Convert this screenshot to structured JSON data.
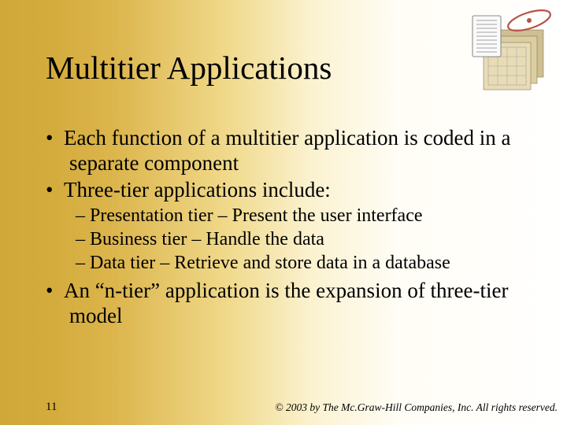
{
  "slide": {
    "title": "Multitier Applications",
    "bullets": {
      "b1": "Each function of a multitier application is coded in a separate component",
      "b2": "Three-tier applications include:",
      "b2a": "Presentation tier – Present the user interface",
      "b2b": "Business tier – Handle the data",
      "b2c": "Data tier – Retrieve and store data in a database",
      "b3": "An “n-tier” application is the expansion of three-tier model"
    },
    "page_number": "11",
    "copyright": "© 2003 by The Mc.Graw-Hill Companies, Inc. All rights reserved."
  }
}
